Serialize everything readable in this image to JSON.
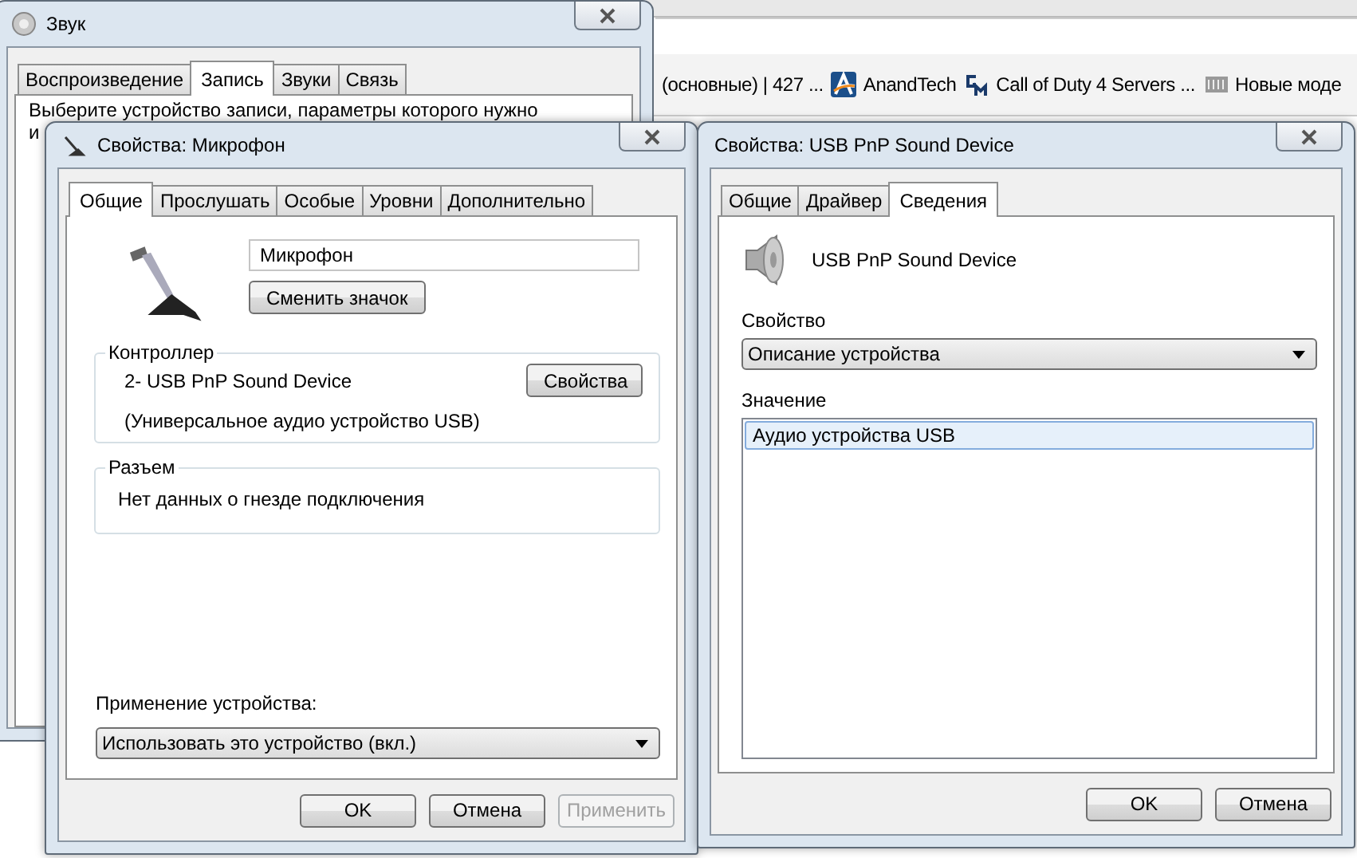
{
  "browser": {
    "bookmarks": [
      {
        "label": "(основные) | 427 ...",
        "kind": "text"
      },
      {
        "label": "AnandTech",
        "kind": "favicon"
      },
      {
        "label": "Call of Duty 4 Servers ...",
        "kind": "favicon"
      },
      {
        "label": "Новые моде",
        "kind": "favicon"
      }
    ]
  },
  "sound_window": {
    "title": "Звук",
    "tabs": [
      {
        "label": "Воспроизведение",
        "selected": false
      },
      {
        "label": "Запись",
        "selected": true
      },
      {
        "label": "Звуки",
        "selected": false
      },
      {
        "label": "Связь",
        "selected": false
      }
    ],
    "prompt_lines": [
      "Выберите устройство записи, параметры которого нужно",
      "и"
    ]
  },
  "mic_window": {
    "title": "Свойства: Микрофон",
    "tabs": [
      {
        "label": "Общие",
        "selected": true
      },
      {
        "label": "Прослушать",
        "selected": false
      },
      {
        "label": "Особые",
        "selected": false
      },
      {
        "label": "Уровни",
        "selected": false
      },
      {
        "label": "Дополнительно",
        "selected": false
      }
    ],
    "device_name": "Микрофон",
    "change_icon_button": "Сменить значок",
    "controller": {
      "heading": "Контроллер",
      "device": "2- USB PnP Sound Device",
      "button": "Свойства",
      "description": "(Универсальное аудио устройство USB)"
    },
    "jack": {
      "heading": "Разъем",
      "text": "Нет данных о гнезде подключения"
    },
    "usage": {
      "label": "Применение устройства:",
      "value": "Использовать это устройство (вкл.)"
    },
    "buttons": [
      {
        "label": "OK",
        "disabled": false
      },
      {
        "label": "Отмена",
        "disabled": false
      },
      {
        "label": "Применить",
        "disabled": true
      }
    ]
  },
  "usb_window": {
    "title": "Свойства: USB PnP Sound Device",
    "tabs": [
      {
        "label": "Общие",
        "selected": false
      },
      {
        "label": "Драйвер",
        "selected": false
      },
      {
        "label": "Сведения",
        "selected": true
      }
    ],
    "device_name": "USB PnP Sound Device",
    "property_label": "Свойство",
    "property_value": "Описание устройства",
    "value_label": "Значение",
    "values": [
      {
        "text": "Аудио устройства USB",
        "selected": true
      }
    ],
    "buttons": [
      {
        "label": "OK",
        "disabled": false
      },
      {
        "label": "Отмена",
        "disabled": false
      }
    ]
  }
}
